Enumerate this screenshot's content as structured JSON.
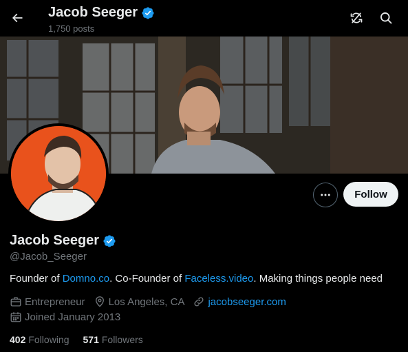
{
  "header": {
    "name": "Jacob Seeger",
    "posts": "1,750 posts"
  },
  "profile": {
    "display_name": "Jacob Seeger",
    "handle": "@Jacob_Seeger",
    "follow_label": "Follow",
    "bio": {
      "part1": "Founder of ",
      "link1": "Domno.co",
      "part2": ". Co-Founder of ",
      "link2": "Faceless.video",
      "part3": ". Making things people need"
    },
    "meta": {
      "profession": "Entrepreneur",
      "location": "Los Angeles, CA",
      "website": "jacobseeger.com",
      "joined": "Joined January 2013"
    },
    "stats": {
      "following_count": "402",
      "following_label": "Following",
      "followers_count": "571",
      "followers_label": "Followers"
    }
  },
  "icons": {
    "back": "arrow-left-icon",
    "refresh": "refresh-off-icon",
    "search": "search-icon",
    "verified": "verified-badge-icon",
    "more": "more-horizontal-icon",
    "profession": "briefcase-icon",
    "location": "location-pin-icon",
    "website": "link-icon",
    "joined": "calendar-icon"
  },
  "colors": {
    "background": "#000000",
    "text_primary": "#e7e9ea",
    "text_secondary": "#71767b",
    "accent": "#1d9bf0",
    "follow_bg": "#eff3f4",
    "avatar_bg": "#e9521c"
  }
}
